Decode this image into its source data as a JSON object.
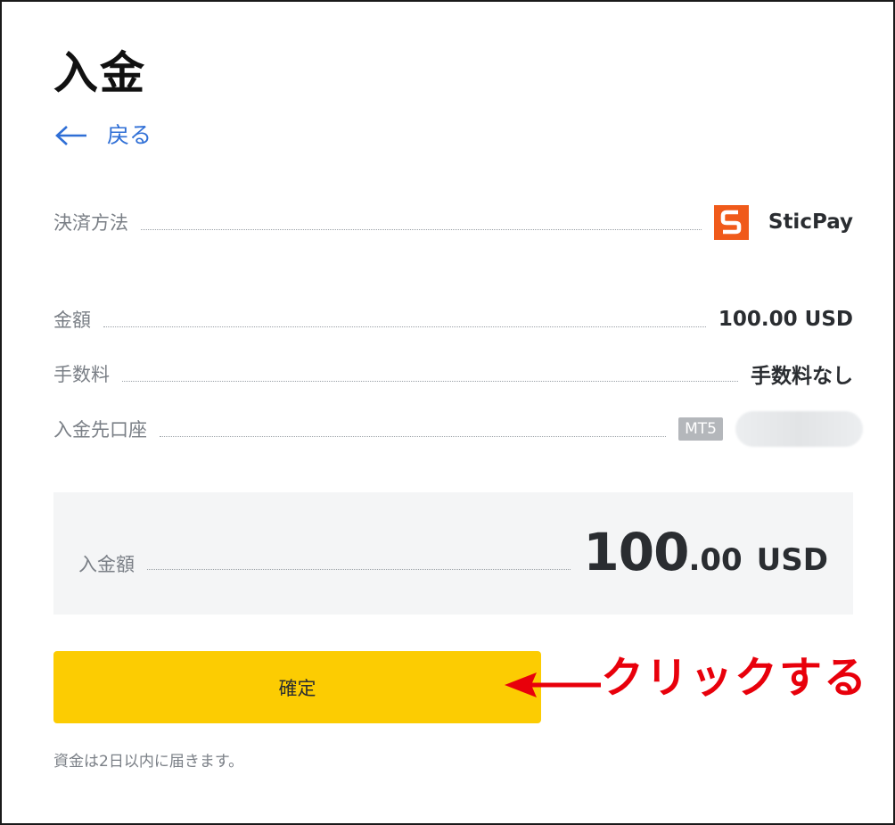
{
  "page": {
    "title": "入金"
  },
  "nav": {
    "back_label": "戻る"
  },
  "details": {
    "payment_method": {
      "label": "決済方法",
      "value": "SticPay",
      "logo_letter": "S",
      "logo_color": "#f05a1a"
    },
    "amount": {
      "label": "金額",
      "value": "100.00 USD"
    },
    "fee": {
      "label": "手数料",
      "value": "手数料なし"
    },
    "destination_account": {
      "label": "入金先口座",
      "badge": "MT5"
    }
  },
  "total": {
    "label": "入金額",
    "integer": "100",
    "decimal": ".00",
    "currency": "USD"
  },
  "actions": {
    "confirm_label": "確定"
  },
  "annotation": {
    "text": "クリックする",
    "color": "#e8000b"
  },
  "note": {
    "text": "資金は2日以内に届きます。"
  },
  "colors": {
    "accent_link": "#2f6fd6",
    "button": "#fccc02",
    "summary_bg": "#f4f5f6"
  },
  "icons": {
    "back": "arrow-left-icon",
    "payment": "sticpay-logo-icon"
  }
}
